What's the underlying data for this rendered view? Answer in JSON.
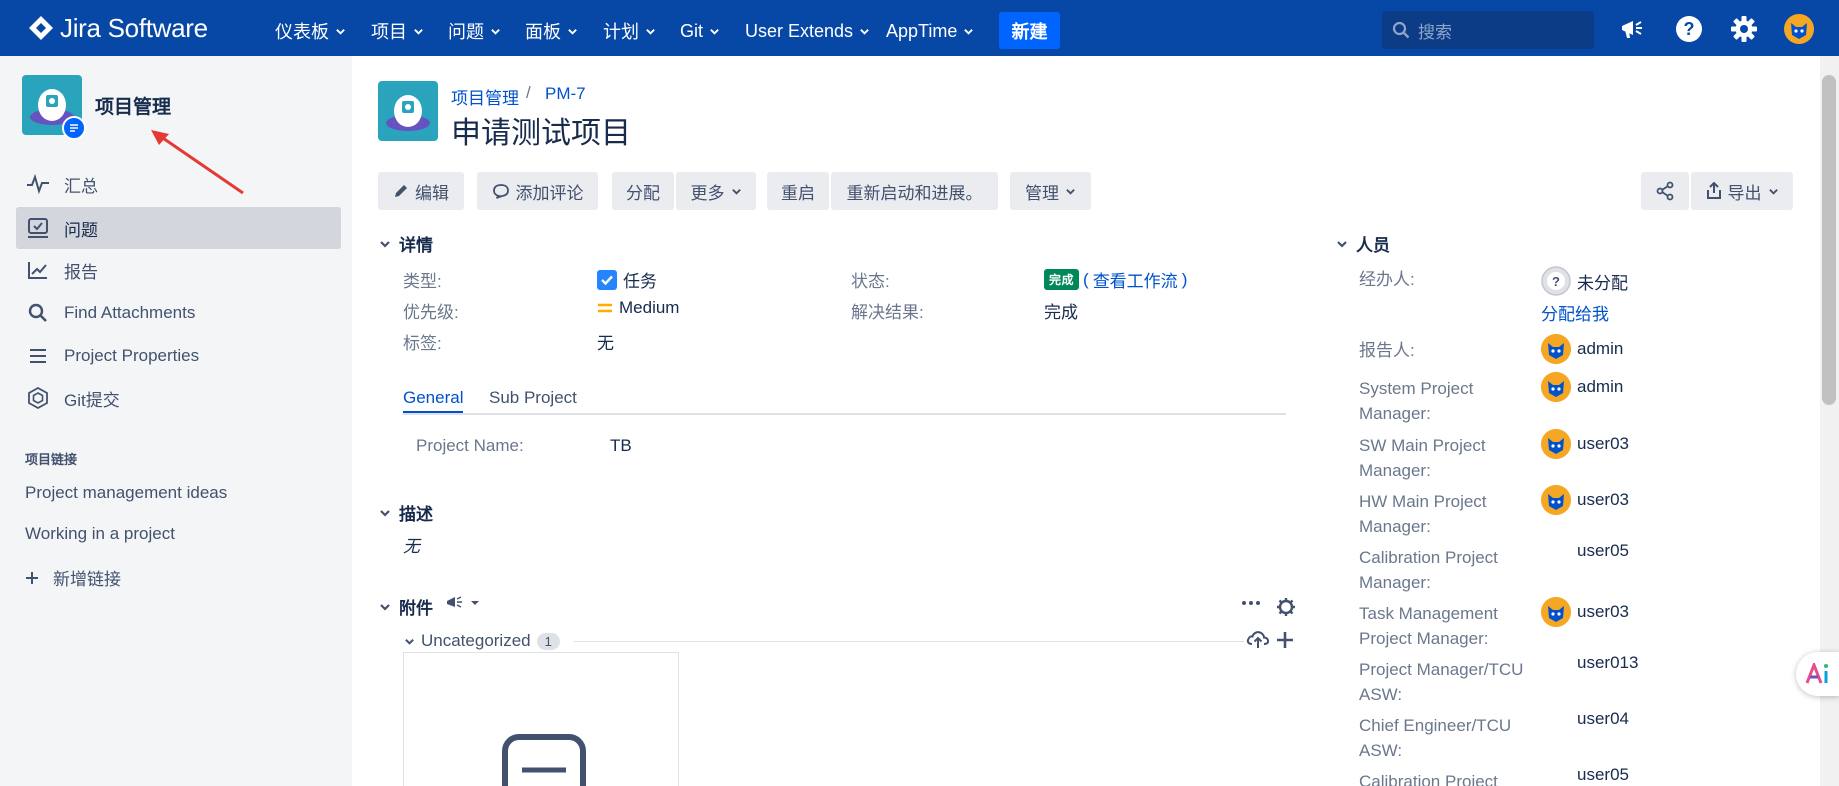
{
  "topnav": {
    "brand": "Jira Software",
    "items": [
      "仪表板",
      "项目",
      "问题",
      "面板",
      "计划",
      "Git",
      "User Extends",
      "AppTime"
    ],
    "create": "新建",
    "search_placeholder": "搜索"
  },
  "sidebar": {
    "project_name": "项目管理",
    "items": [
      {
        "label": "汇总",
        "icon": "pulse-icon"
      },
      {
        "label": "问题",
        "icon": "issues-icon"
      },
      {
        "label": "报告",
        "icon": "reports-icon"
      },
      {
        "label": "Find Attachments",
        "icon": "search-icon"
      },
      {
        "label": "Project Properties",
        "icon": "list-icon"
      },
      {
        "label": "Git提交",
        "icon": "git-icon"
      }
    ],
    "section_title": "项目链接",
    "links": [
      "Project management ideas",
      "Working in a project"
    ],
    "add_link": "新增链接"
  },
  "issue": {
    "breadcrumb_project": "项目管理",
    "breadcrumb_sep": "/",
    "key": "PM-7",
    "title": "申请测试项目"
  },
  "toolbar": {
    "edit": "编辑",
    "comment": "添加评论",
    "assign": "分配",
    "more": "更多",
    "reopen": "重启",
    "restart": "重新启动和进展。",
    "admin": "管理",
    "export": "导出"
  },
  "details": {
    "title": "详情",
    "type_label": "类型:",
    "type_value": "任务",
    "priority_label": "优先级:",
    "priority_value": "Medium",
    "labels_label": "标签:",
    "labels_value": "无",
    "status_label": "状态:",
    "status_value": "完成",
    "view_workflow": "查看工作流",
    "paren_open": "(",
    "paren_close": ")",
    "resolution_label": "解决结果:",
    "resolution_value": "完成",
    "tabs": [
      "General",
      "Sub Project"
    ],
    "project_name_label": "Project Name:",
    "project_name_value": "TB"
  },
  "description": {
    "title": "描述",
    "value": "无"
  },
  "attachments": {
    "title": "附件",
    "group": "Uncategorized",
    "count": "1"
  },
  "people": {
    "title": "人员",
    "assignee_label": "经办人:",
    "assignee_value": "未分配",
    "assign_to_me": "分配给我",
    "rows": [
      {
        "label": "报告人:",
        "value": "admin"
      },
      {
        "label": "System Project Manager:",
        "value": "admin"
      },
      {
        "label": "SW Main Project Manager:",
        "value": "user03"
      },
      {
        "label": "HW Main Project Manager:",
        "value": "user03"
      },
      {
        "label": "Calibration Project Manager:",
        "value": "user05"
      },
      {
        "label": "Task Management Project Manager:",
        "value": "user03"
      },
      {
        "label": "Project Manager/TCU ASW:",
        "value": "user013"
      },
      {
        "label": "Chief Engineer/TCU ASW:",
        "value": "user04"
      },
      {
        "label": "Calibration Project",
        "value": "user05"
      }
    ]
  },
  "colors": {
    "nav": "#0747a6",
    "primary": "#0052cc",
    "done": "#00875a",
    "sidebar": "#f4f5f7"
  }
}
